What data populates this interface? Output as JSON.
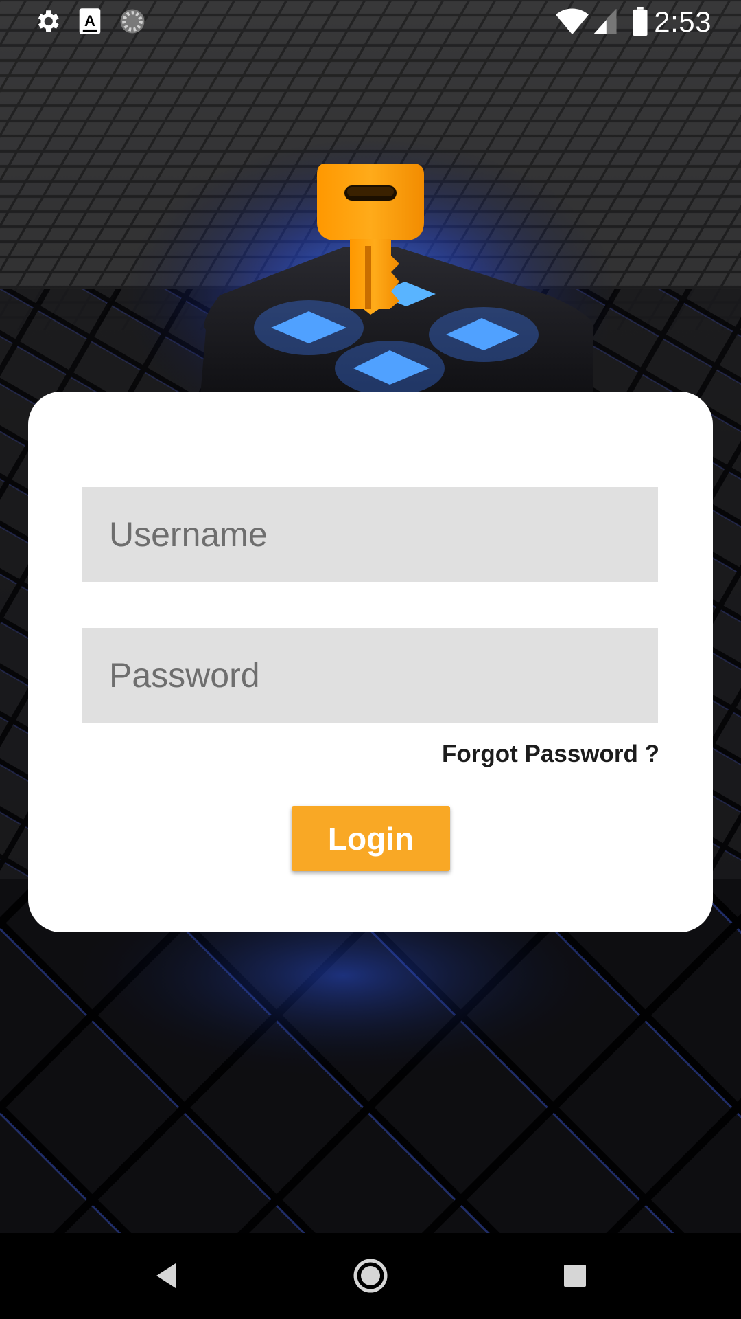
{
  "status_bar": {
    "time": "2:53",
    "left_icons": [
      "gear-icon",
      "keyboard-a-icon",
      "sync-spinner-icon"
    ],
    "right_icons": [
      "wifi-icon",
      "cell-signal-icon",
      "battery-icon"
    ]
  },
  "login_form": {
    "username_placeholder": "Username",
    "username_value": "",
    "password_placeholder": "Password",
    "password_value": "",
    "forgot_password_label": "Forgot Password ?",
    "login_label": "Login"
  },
  "navigation": {
    "buttons": [
      "back-icon",
      "home-icon",
      "recents-icon"
    ]
  },
  "colors": {
    "accent": "#f9a825",
    "key": "#ff9f00",
    "glow": "#2f6bff",
    "card": "#ffffff",
    "field": "#e0e0e0"
  }
}
